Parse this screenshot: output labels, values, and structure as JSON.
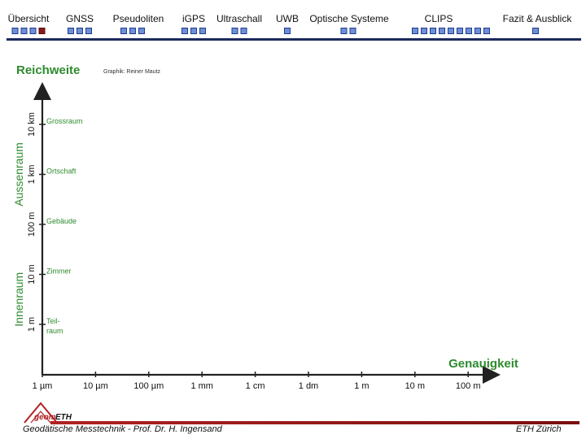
{
  "nav": {
    "items": [
      {
        "label": "Übersicht",
        "dots": 4,
        "active": 3
      },
      {
        "label": "GNSS",
        "dots": 3,
        "active": -1
      },
      {
        "label": "Pseudoliten",
        "dots": 3,
        "active": -1
      },
      {
        "label": "iGPS",
        "dots": 3,
        "active": -1
      },
      {
        "label": "Ultraschall",
        "dots": 2,
        "active": -1
      },
      {
        "label": "UWB",
        "dots": 1,
        "active": -1
      },
      {
        "label": "Optische Systeme",
        "dots": 2,
        "active": -1
      },
      {
        "label": "CLIPS",
        "dots": 9,
        "active": -1
      },
      {
        "label": "Fazit & Ausblick",
        "dots": 1,
        "active": -1
      }
    ]
  },
  "slide": {
    "title": "Reichweite",
    "credit": "Graphik: Reiner Mautz"
  },
  "chart_data": {
    "type": "scatter",
    "title": "",
    "xlabel": "Genauigkeit",
    "ylabel": "",
    "x_ticks": [
      "1 µm",
      "10 µm",
      "100 µm",
      "1 mm",
      "1 cm",
      "1 dm",
      "1 m",
      "10 m",
      "100 m"
    ],
    "y_ticks": [
      "1 m",
      "10 m",
      "100 m",
      "1 km",
      "10 km"
    ],
    "y_categories": [
      "Teil-\nraum",
      "Zimmer",
      "Gebäude",
      "Ortschaft",
      "Grossraum"
    ],
    "y_groups": [
      {
        "label": "Innenraum",
        "range": [
          "1 m",
          "10 m"
        ]
      },
      {
        "label": "Aussenraum",
        "range": [
          "100 m",
          "10 km"
        ]
      }
    ],
    "series": [],
    "colors": {
      "category": "#2e8b2e",
      "axis": "#222222"
    }
  },
  "footer": {
    "left": "Geodätische Messtechnik - Prof. Dr. H. Ingensand",
    "right": "ETH Zürich",
    "logo_geom": "geom",
    "logo_eth": "ETH"
  }
}
